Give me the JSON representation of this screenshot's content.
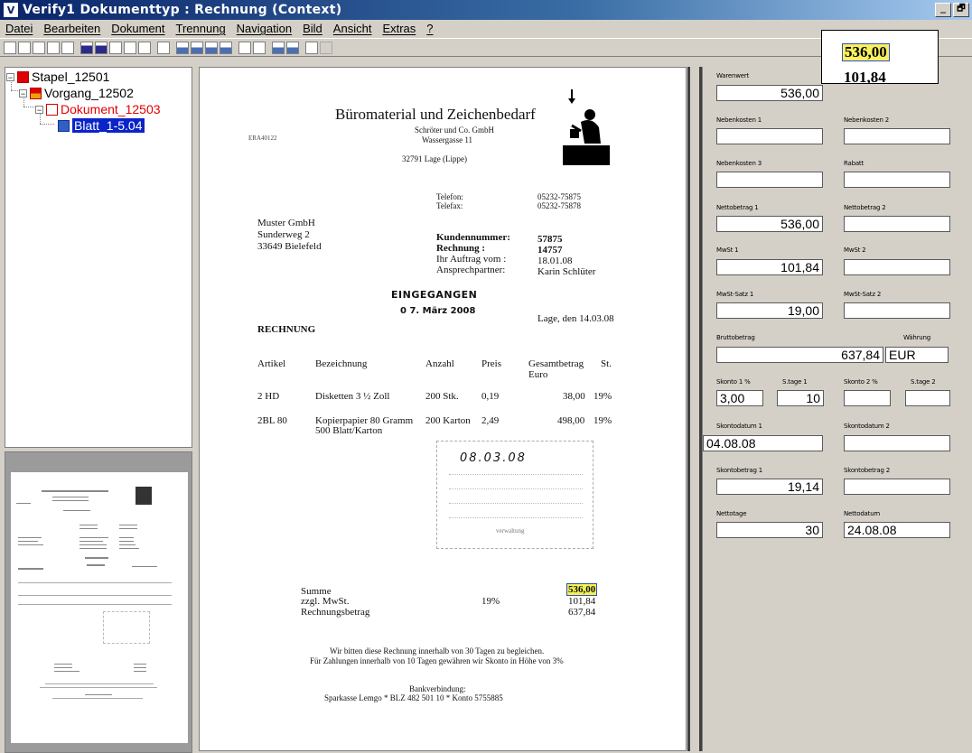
{
  "window": {
    "title": "Verify1 Dokumenttyp : Rechnung (Context)",
    "minimize": "_",
    "restore": "🗗"
  },
  "menu": [
    "Datei",
    "Bearbeiten",
    "Dokument",
    "Trennung",
    "Navigation",
    "Bild",
    "Ansicht",
    "Extras",
    "?"
  ],
  "tree": {
    "stapel": "Stapel_12501",
    "vorgang": "Vorgang_12502",
    "dokument": "Dokument_12503",
    "blatt": "Blatt_1-5.04"
  },
  "document": {
    "company": "Büromaterial und Zeichenbedarf",
    "company_sub": "Schröter und Co. GmbH",
    "street": "Wassergasse 11",
    "city": "32791 Lage (Lippe)",
    "ref": "ERA40122",
    "telefon_label": "Telefon:",
    "telefon": "05232-75875",
    "telefax_label": "Telefax:",
    "telefax": "05232-75878",
    "recipient": [
      "Muster GmbH",
      "Sunderweg 2",
      "33649 Bielefeld"
    ],
    "kunde_label": "Kundennummer:",
    "kunde": "57875",
    "rechnung_label": "Rechnung :",
    "rechnung": "14757",
    "auftrag_label": "Ihr Auftrag vom :",
    "auftrag": "18.01.08",
    "ansprech_label": "Ansprechpartner:",
    "ansprech": "Karin Schlüter",
    "stamp1": "EINGEGANGEN",
    "stamp2": "0 7. März 2008",
    "date_line": "Lage, den 14.03.08",
    "heading": "RECHNUNG",
    "table_headers": [
      "Artikel",
      "Bezeichnung",
      "Anzahl",
      "Preis",
      "Gesamtbetrag",
      "St."
    ],
    "euro": "Euro",
    "rows": [
      {
        "artikel": "2 HD",
        "bez": "Disketten 3 ½ Zoll",
        "anzahl": "200 Stk.",
        "preis": "0,19",
        "gesamt": "38,00",
        "st": "19%"
      },
      {
        "artikel": "2BL 80",
        "bez": "Kopierpapier 80 Gramm",
        "bez2": "500 Blatt/Karton",
        "anzahl": "200 Karton",
        "preis": "2,49",
        "gesamt": "498,00",
        "st": "19%"
      }
    ],
    "handwritten": "08.03.08",
    "stamp_footer": "verwaltung",
    "summe_label": "Summe",
    "summe": "536,00",
    "mwst_label": "zzgl. MwSt.",
    "mwst_pct": "19%",
    "mwst": "101,84",
    "rbetrag_label": "Rechnungsbetrag",
    "rbetrag": "637,84",
    "footer1": "Wir bitten diese Rechnung innerhalb von 30 Tagen zu begleichen.",
    "footer2": "Für Zahlungen innerhalb von 10 Tagen gewähren wir Skonto in Höhe von 3%",
    "bank_label": "Bankverbindung:",
    "bank": "Sparkasse Lemgo * BLZ 482 501 10 * Konto 5755885"
  },
  "zoom": {
    "value": "536,00",
    "next": "101,84"
  },
  "form": {
    "warenwert": {
      "label": "Warenwert",
      "value": "536,00"
    },
    "nebenkosten1": {
      "label": "Nebenkosten 1",
      "value": ""
    },
    "nebenkosten2": {
      "label": "Nebenkosten 2",
      "value": ""
    },
    "nebenkosten3": {
      "label": "Nebenkosten 3",
      "value": ""
    },
    "rabatt": {
      "label": "Rabatt",
      "value": ""
    },
    "netto1": {
      "label": "Nettobetrag 1",
      "value": "536,00"
    },
    "netto2": {
      "label": "Nettobetrag 2",
      "value": ""
    },
    "mwst1": {
      "label": "MwSt 1",
      "value": "101,84"
    },
    "mwst2": {
      "label": "MwSt 2",
      "value": ""
    },
    "mwstsatz1": {
      "label": "MwSt-Satz 1",
      "value": "19,00"
    },
    "mwstsatz2": {
      "label": "MwSt-Satz 2",
      "value": ""
    },
    "brutto": {
      "label": "Bruttobetrag",
      "value": "637,84"
    },
    "waehrung": {
      "label": "Währung",
      "value": "EUR"
    },
    "skonto1": {
      "label": "Skonto 1 %",
      "value": "3,00"
    },
    "stage1": {
      "label": "S.tage 1",
      "value": "10"
    },
    "skonto2": {
      "label": "Skonto 2 %",
      "value": ""
    },
    "stage2": {
      "label": "S.tage 2",
      "value": ""
    },
    "skontodatum1": {
      "label": "Skontodatum 1",
      "value": "04.08.08"
    },
    "skontodatum2": {
      "label": "Skontodatum 2",
      "value": ""
    },
    "skontobetrag1": {
      "label": "Skontobetrag 1",
      "value": "19,14"
    },
    "skontobetrag2": {
      "label": "Skontobetrag 2",
      "value": ""
    },
    "nettotage": {
      "label": "Nettotage",
      "value": "30"
    },
    "nettodatum": {
      "label": "Nettodatum",
      "value": "24.08.08"
    }
  }
}
